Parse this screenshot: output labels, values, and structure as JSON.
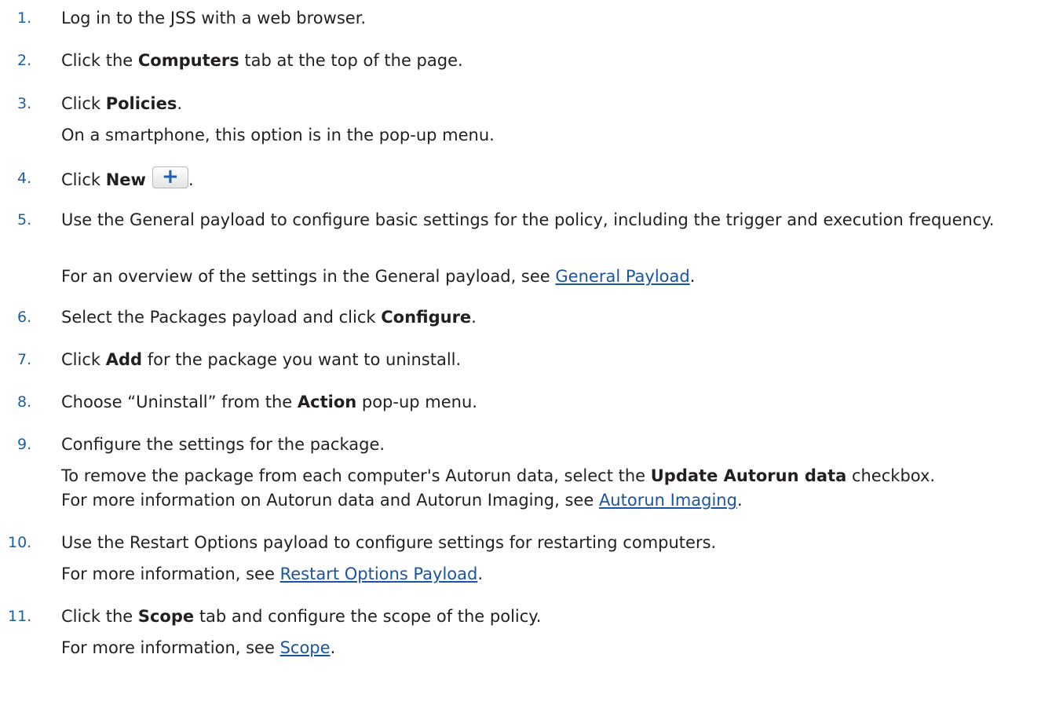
{
  "steps": [
    {
      "num": "1.",
      "text": "Log in to the JSS with a web browser."
    },
    {
      "num": "2.",
      "pre": "Click the ",
      "bold": "Computers",
      "post": " tab at the top of the page."
    },
    {
      "num": "3.",
      "pre": "Click ",
      "bold": "Policies",
      "post": ".",
      "note": "On a smartphone, this option is in the pop-up menu."
    },
    {
      "num": "4.",
      "pre": "Click ",
      "bold": "New",
      "post": ".",
      "button_icon": "plus-icon",
      "button_glyph": "+"
    },
    {
      "num": "5.",
      "text": "Use the General payload to configure basic settings for the policy, including the trigger and execution frequency.",
      "note_pre": "For an overview of the settings in the General payload, see ",
      "link": "General Payload",
      "note_post": "."
    },
    {
      "num": "6.",
      "pre": "Select the Packages payload and click ",
      "bold": "Configure",
      "post": "."
    },
    {
      "num": "7.",
      "pre": "Click ",
      "bold": "Add",
      "post": " for the package you want to uninstall."
    },
    {
      "num": "8.",
      "pre": "Choose “Uninstall” from the ",
      "bold": "Action",
      "post": " pop-up menu."
    },
    {
      "num": "9.",
      "text": "Configure the settings for the package.",
      "note1_pre": "To remove the package from each computer's Autorun data, select the ",
      "note1_bold": "Update Autorun data",
      "note1_post": " checkbox.",
      "note2_pre": "For more information on Autorun data and Autorun Imaging, see ",
      "link": "Autorun Imaging",
      "note2_post": "."
    },
    {
      "num": "10.",
      "text": "Use the Restart Options payload to configure settings for restarting computers.",
      "note_pre": "For more information, see ",
      "link": "Restart Options Payload",
      "note_post": "."
    },
    {
      "num": "11.",
      "pre": "Click the ",
      "bold": "Scope",
      "post": " tab and configure the scope of the policy.",
      "note_pre": "For more information, see ",
      "link": "Scope",
      "note_post": "."
    }
  ]
}
